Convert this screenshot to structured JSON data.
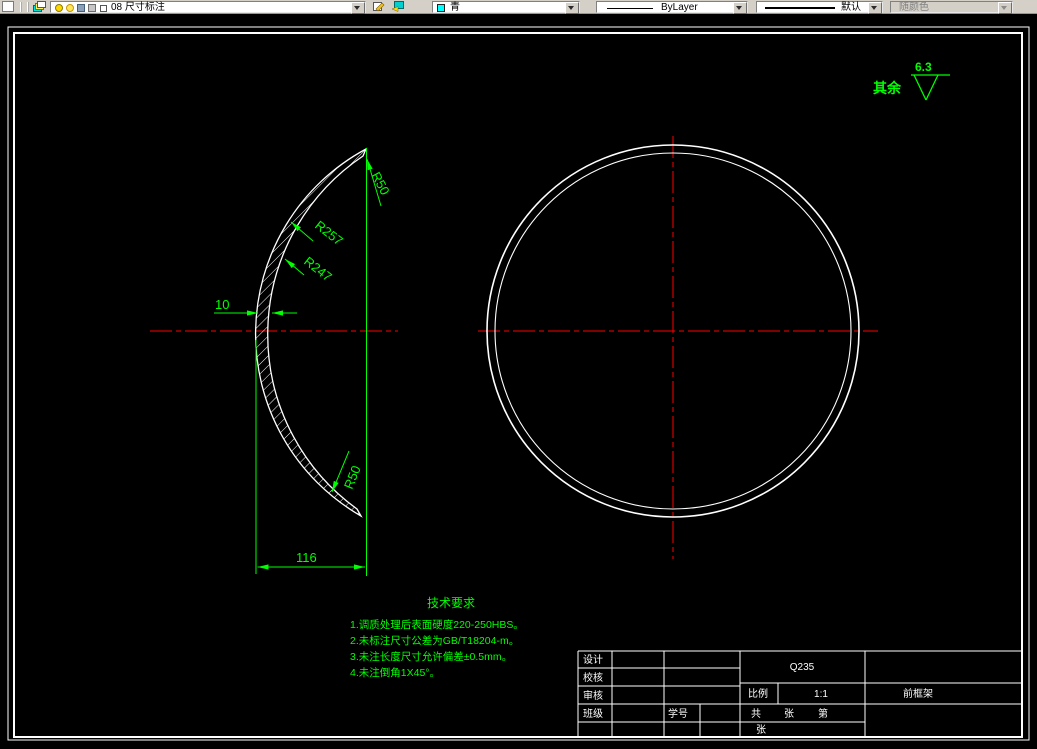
{
  "toolbar": {
    "layer_combo": {
      "value": "08 尺寸标注"
    },
    "color_combo": {
      "value": "青",
      "swatch_color": "#00ffff"
    },
    "linetype_combo": {
      "value": "ByLayer"
    },
    "lineweight_combo": {
      "value": "默认"
    },
    "plotstyle_combo": {
      "value": "随颜色"
    }
  },
  "drawing": {
    "colors": {
      "background": "#000000",
      "outline": "#ffffff",
      "dimension": "#00ff00",
      "centerline": "#ff0000"
    },
    "dimensions": {
      "r50_top": "R50",
      "r257": "R257",
      "r247": "R247",
      "thickness": "10",
      "r50_bottom": "R50",
      "width": "116"
    },
    "roughness": {
      "label": "其余",
      "value": "6.3"
    },
    "tech_requirements": {
      "title": "技术要求",
      "items": [
        "1.调质处理后表面硬度220-250HBS。",
        "2.未标注尺寸公差为GB/T18204-m。",
        "3.未注长度尺寸允许偏差±0.5mm。",
        "4.未注倒角1X45°。"
      ]
    },
    "title_block": {
      "design": "设计",
      "check": "校核",
      "audit": "审核",
      "class_label": "班级",
      "student_label": "学号",
      "material": "Q235",
      "scale_label": "比例",
      "scale_value": "1:1",
      "part_name": "前框架",
      "total_label": "共",
      "sheet_label": "张",
      "no_label": "第",
      "sheet_label2": "张"
    }
  }
}
